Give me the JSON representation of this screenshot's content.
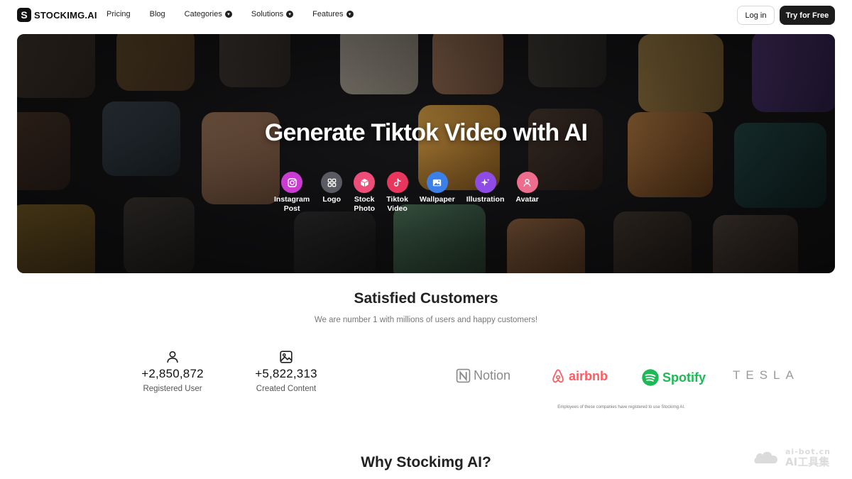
{
  "nav": {
    "logo_mark": "S",
    "logo_text": "STOCKIMG.AI",
    "links": [
      {
        "label": "Pricing",
        "has_dropdown": false
      },
      {
        "label": "Blog",
        "has_dropdown": false
      },
      {
        "label": "Categories",
        "has_dropdown": true
      },
      {
        "label": "Solutions",
        "has_dropdown": true
      },
      {
        "label": "Features",
        "has_dropdown": true
      }
    ],
    "login_label": "Log in",
    "try_label": "Try for Free"
  },
  "hero": {
    "title": "Generate Tiktok Video  with AI",
    "categories": [
      {
        "label_1": "Instagram",
        "label_2": "Post",
        "icon": "instagram-icon",
        "color": "#c93bd1"
      },
      {
        "label_1": "Logo",
        "label_2": "",
        "icon": "grid-icon",
        "color": "#5a5a62"
      },
      {
        "label_1": "Stock",
        "label_2": "Photo",
        "icon": "cube-icon",
        "color": "#ee4d7a"
      },
      {
        "label_1": "Tiktok",
        "label_2": "Video",
        "icon": "tiktok-icon",
        "color": "#e8365d"
      },
      {
        "label_1": "Wallpaper",
        "label_2": "",
        "icon": "image-icon",
        "color": "#3b7fe8"
      },
      {
        "label_1": "Illustration",
        "label_2": "",
        "icon": "sparkle-icon",
        "color": "#8f4be6"
      },
      {
        "label_1": "Avatar",
        "label_2": "",
        "icon": "person-icon",
        "color": "#ee6d8e"
      }
    ]
  },
  "customers": {
    "title": "Satisfied Customers",
    "subtitle": "We are number 1 with millions of users and happy customers!",
    "stats": [
      {
        "value": "+2,850,872",
        "label": "Registered User",
        "icon": "user-icon"
      },
      {
        "value": "+5,822,313",
        "label": "Created Content",
        "icon": "image-icon"
      }
    ],
    "brands": [
      {
        "name": "Notion",
        "color": "#8a8a8a"
      },
      {
        "name": "airbnb",
        "color": "#ff5a5f"
      },
      {
        "name": "Spotify",
        "color": "#1db954"
      },
      {
        "name": "TESLA",
        "color": "#9a9a9a"
      }
    ],
    "brands_note": "Employees of these companies have registered to use Stockimg AI."
  },
  "why_title": "Why Stockimg AI?",
  "watermark": {
    "line_1": "ai-bot.cn",
    "line_2": "AI工具集"
  }
}
